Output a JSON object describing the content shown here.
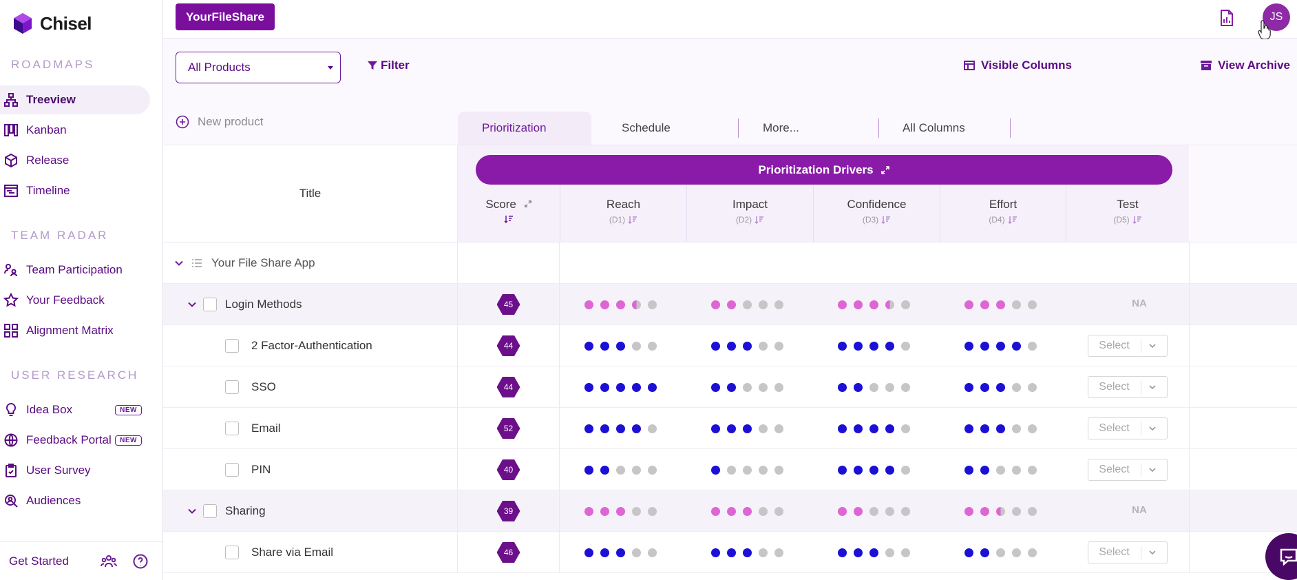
{
  "app": {
    "name": "Chisel",
    "brand_button": "YourFileShare",
    "avatar_initials": "JS"
  },
  "sidebar": {
    "sections": [
      {
        "title": "ROADMAPS"
      },
      {
        "title": "TEAM RADAR"
      },
      {
        "title": "USER RESEARCH"
      }
    ],
    "items": [
      {
        "label": "Treeview",
        "icon": "treeview-icon",
        "active": true
      },
      {
        "label": "Kanban",
        "icon": "kanban-icon"
      },
      {
        "label": "Release",
        "icon": "release-icon"
      },
      {
        "label": "Timeline",
        "icon": "timeline-icon"
      },
      {
        "label": "Team Participation",
        "icon": "team-participation-icon"
      },
      {
        "label": "Your Feedback",
        "icon": "star-icon"
      },
      {
        "label": "Alignment Matrix",
        "icon": "matrix-icon"
      },
      {
        "label": "Idea Box",
        "icon": "lightbulb-icon",
        "badge": "NEW"
      },
      {
        "label": "Feedback Portal",
        "icon": "globe-icon",
        "badge": "NEW"
      },
      {
        "label": "User Survey",
        "icon": "clipboard-icon"
      },
      {
        "label": "Audiences",
        "icon": "audience-search-icon"
      }
    ],
    "footer": {
      "label": "Get Started"
    }
  },
  "toolbar": {
    "product_select": "All Products",
    "filter": "Filter",
    "visible_columns": "Visible Columns",
    "view_archive": "View Archive",
    "new_product": "New product"
  },
  "tabs": [
    "Prioritization",
    "Schedule",
    "More...",
    "All Columns"
  ],
  "grid": {
    "title_header": "Title",
    "drivers_label": "Prioritization Drivers",
    "columns": [
      {
        "name": "Score",
        "sub": ""
      },
      {
        "name": "Reach",
        "sub": "(D1)"
      },
      {
        "name": "Impact",
        "sub": "(D2)"
      },
      {
        "name": "Confidence",
        "sub": "(D3)"
      },
      {
        "name": "Effort",
        "sub": "(D4)"
      },
      {
        "name": "Test",
        "sub": "(D5)"
      }
    ],
    "select_label": "Select",
    "na_label": "NA",
    "rows": [
      {
        "type": "app",
        "title": "Your File Share App"
      },
      {
        "type": "group",
        "title": "Login Methods",
        "score": "45",
        "reach": "3.5",
        "impact": "2",
        "confidence": "3.5",
        "effort": "3",
        "test": "NA"
      },
      {
        "type": "item",
        "title": "2 Factor-Authentication",
        "score": "44",
        "reach": "3",
        "impact": "3",
        "confidence": "4",
        "effort": "4",
        "test": "Select"
      },
      {
        "type": "item",
        "title": "SSO",
        "score": "44",
        "reach": "5",
        "impact": "2",
        "confidence": "2",
        "effort": "3",
        "test": "Select"
      },
      {
        "type": "item",
        "title": "Email",
        "score": "52",
        "reach": "4",
        "impact": "3",
        "confidence": "4",
        "effort": "3",
        "test": "Select"
      },
      {
        "type": "item",
        "title": "PIN",
        "score": "40",
        "reach": "2",
        "impact": "1",
        "confidence": "4",
        "effort": "2",
        "test": "Select"
      },
      {
        "type": "group",
        "title": "Sharing",
        "score": "39",
        "reach": "3",
        "impact": "3",
        "confidence": "2",
        "effort": "2.5",
        "test": "NA"
      },
      {
        "type": "item",
        "title": "Share via Email",
        "score": "46",
        "reach": "3",
        "impact": "3",
        "confidence": "3",
        "effort": "2",
        "test": "Select"
      }
    ]
  },
  "colors": {
    "accent": "#7a0f9e",
    "dot_filled": "#1b10d4",
    "dot_group": "#de66d3",
    "dot_empty": "#c6c6c6"
  }
}
